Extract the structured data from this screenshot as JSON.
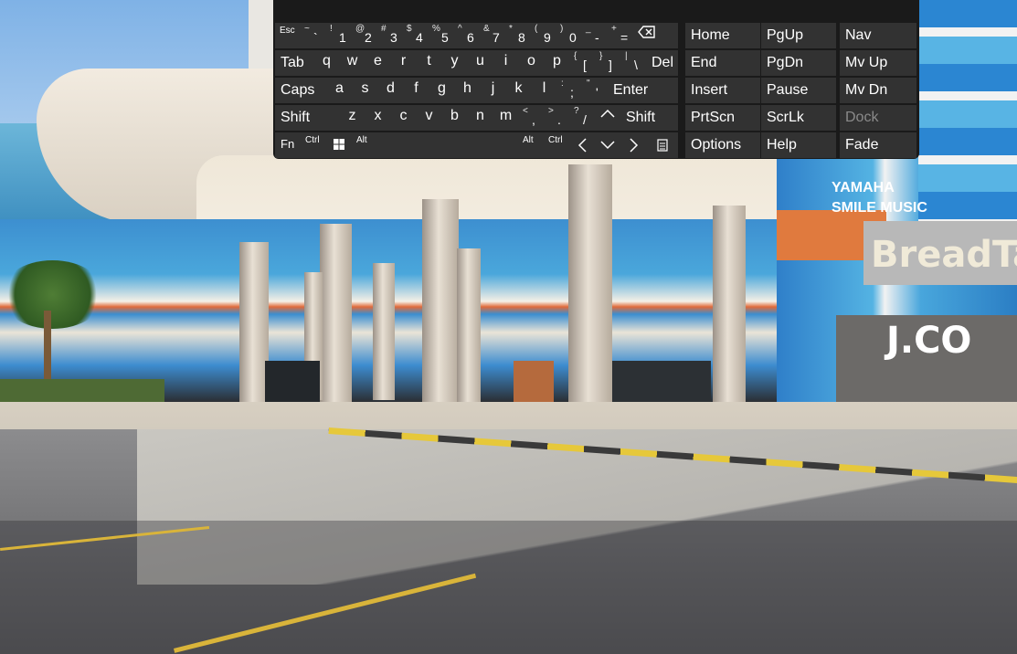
{
  "background": {
    "signs": {
      "yamaha": "YAMAHA\nSMILE MUSIC",
      "breadtalk": "BreadTal",
      "jco": "J.CO"
    }
  },
  "keyboard": {
    "row1": [
      {
        "label": "Esc"
      },
      {
        "top": "~",
        "bottom": "`"
      },
      {
        "top": "!",
        "bottom": "1"
      },
      {
        "top": "@",
        "bottom": "2"
      },
      {
        "top": "#",
        "bottom": "3"
      },
      {
        "top": "$",
        "bottom": "4"
      },
      {
        "top": "%",
        "bottom": "5"
      },
      {
        "top": "^",
        "bottom": "6"
      },
      {
        "top": "&",
        "bottom": "7"
      },
      {
        "top": "*",
        "bottom": "8"
      },
      {
        "top": "(",
        "bottom": "9"
      },
      {
        "top": ")",
        "bottom": "0"
      },
      {
        "top": "_",
        "bottom": "-"
      },
      {
        "top": "+",
        "bottom": "="
      },
      {
        "icon": "backspace-icon"
      }
    ],
    "row2": [
      {
        "label": "Tab"
      },
      {
        "label": "q"
      },
      {
        "label": "w"
      },
      {
        "label": "e"
      },
      {
        "label": "r"
      },
      {
        "label": "t"
      },
      {
        "label": "y"
      },
      {
        "label": "u"
      },
      {
        "label": "i"
      },
      {
        "label": "o"
      },
      {
        "label": "p"
      },
      {
        "top": "{",
        "bottom": "["
      },
      {
        "top": "}",
        "bottom": "]"
      },
      {
        "top": "|",
        "bottom": "\\"
      },
      {
        "label": "Del"
      }
    ],
    "row3": [
      {
        "label": "Caps"
      },
      {
        "label": "a"
      },
      {
        "label": "s"
      },
      {
        "label": "d"
      },
      {
        "label": "f"
      },
      {
        "label": "g"
      },
      {
        "label": "h"
      },
      {
        "label": "j"
      },
      {
        "label": "k"
      },
      {
        "label": "l"
      },
      {
        "top": ":",
        "bottom": ";"
      },
      {
        "top": "\"",
        "bottom": "'"
      },
      {
        "label": "Enter"
      }
    ],
    "row4": [
      {
        "label": "Shift"
      },
      {
        "label": "z"
      },
      {
        "label": "x"
      },
      {
        "label": "c"
      },
      {
        "label": "v"
      },
      {
        "label": "b"
      },
      {
        "label": "n"
      },
      {
        "label": "m"
      },
      {
        "top": "<",
        "bottom": ","
      },
      {
        "top": ">",
        "bottom": "."
      },
      {
        "top": "?",
        "bottom": "/"
      },
      {
        "icon": "arrow-up-icon"
      },
      {
        "label": "Shift"
      }
    ],
    "row5": [
      {
        "label": "Fn"
      },
      {
        "label": "Ctrl"
      },
      {
        "icon": "windows-icon"
      },
      {
        "label": "Alt"
      },
      {
        "label": ""
      },
      {
        "label": "Alt"
      },
      {
        "label": "Ctrl"
      },
      {
        "icon": "arrow-left-icon"
      },
      {
        "icon": "arrow-down-icon"
      },
      {
        "icon": "arrow-right-icon"
      },
      {
        "icon": "menu-icon"
      }
    ],
    "nav_col1": [
      "Home",
      "End",
      "Insert",
      "PrtScn",
      "Options"
    ],
    "nav_col2": [
      "PgUp",
      "PgDn",
      "Pause",
      "ScrLk",
      "Help"
    ],
    "nav_col3": [
      "Nav",
      "Mv Up",
      "Mv Dn",
      "Dock",
      "Fade"
    ],
    "disabled": [
      "Dock"
    ]
  }
}
